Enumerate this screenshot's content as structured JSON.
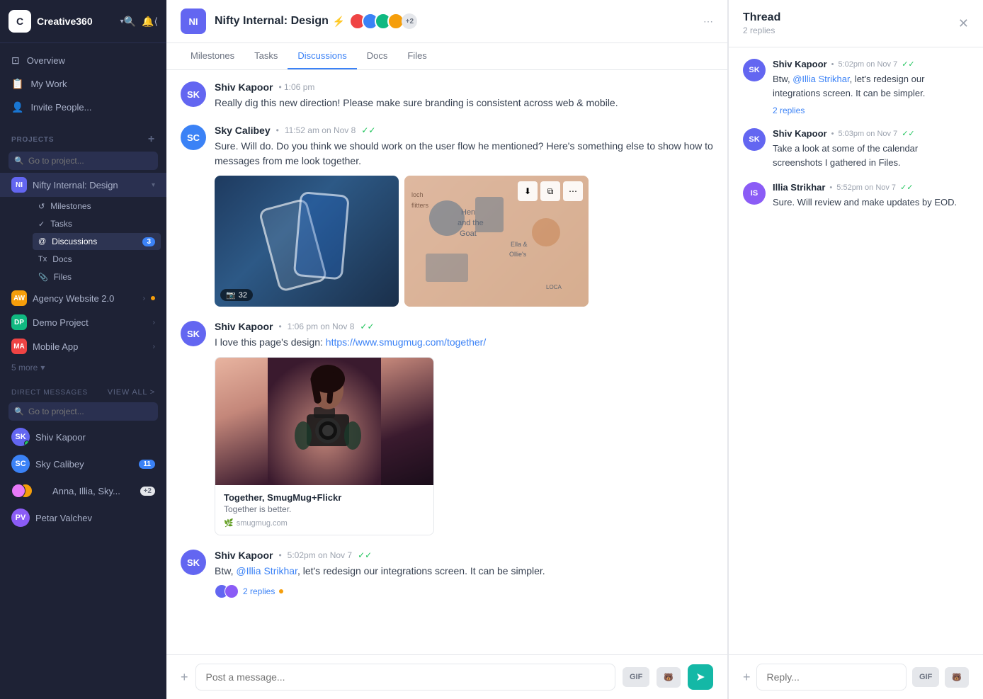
{
  "sidebar": {
    "brand": {
      "logo": "C",
      "name": "Creative360",
      "chevron": "▾"
    },
    "nav": {
      "overview_label": "Overview",
      "my_work_label": "My Work",
      "invite_label": "Invite People..."
    },
    "projects_section_label": "PROJECTS",
    "projects_search_placeholder": "Go to project...",
    "projects": [
      {
        "id": "NI",
        "name": "Nifty Internal: Design",
        "color": "#6366f1",
        "active": true
      },
      {
        "id": "AW",
        "name": "Agency Website 2.0",
        "color": "#f59e0b",
        "dot": true
      },
      {
        "id": "DP",
        "name": "Demo Project",
        "color": "#10b981"
      },
      {
        "id": "MA",
        "name": "Mobile App",
        "color": "#ef4444"
      }
    ],
    "more_label": "5 more",
    "ni_sub_nav": [
      {
        "icon": "↺",
        "label": "Milestones"
      },
      {
        "icon": "✓",
        "label": "Tasks"
      },
      {
        "icon": "@",
        "label": "Discussions",
        "badge": "3",
        "active": true
      },
      {
        "icon": "Tx",
        "label": "Docs"
      },
      {
        "icon": "📎",
        "label": "Files"
      }
    ],
    "dm_section_label": "DIRECT MESSAGES",
    "dm_view_all": "View all >",
    "dm_search_placeholder": "Go to project...",
    "dm_items": [
      {
        "name": "Shiv Kapoor",
        "color": "#6366f1",
        "initials": "SK",
        "online": true
      },
      {
        "name": "Sky Calibey",
        "color": "#3b82f6",
        "initials": "SC",
        "badge": "11"
      },
      {
        "name": "Anna, Illia, Sky...",
        "multi": true
      },
      {
        "name": "Petar Valchev",
        "color": "#8b5cf6",
        "initials": "PV"
      }
    ]
  },
  "project_header": {
    "avatar_text": "NI",
    "title": "Nifty Internal: Design",
    "member_count_extra": "+2",
    "tabs": [
      "Milestones",
      "Tasks",
      "Discussions",
      "Docs",
      "Files"
    ],
    "active_tab": "Discussions"
  },
  "messages": [
    {
      "id": "msg1",
      "author": "Sky Calibey",
      "author_color": "#3b82f6",
      "author_initials": "SC",
      "time": "11:52 am on Nov 8",
      "verified": true,
      "text": "Sure. Will do. Do you think we should work on the user flow he mentioned? Here's something else to show how to messages from me look together.",
      "has_images": true,
      "image_count": 32
    },
    {
      "id": "msg2",
      "author": "Shiv Kapoor",
      "author_color": "#6366f1",
      "author_initials": "SK",
      "time": "1:06 pm on Nov 8",
      "verified": true,
      "text_prefix": "I love this page's design: ",
      "link": "https://www.smugmug.com/together/",
      "has_link_preview": true,
      "link_preview_title": "Together, SmugMug+Flickr",
      "link_preview_subtitle": "Together is better.",
      "link_preview_domain": "smugmug.com"
    },
    {
      "id": "msg3",
      "author": "Shiv Kapoor",
      "author_color": "#6366f1",
      "author_initials": "SK",
      "time": "5:02pm on Nov 7",
      "verified": true,
      "text_prefix": "Btw, ",
      "mention": "@Illia Strikhar",
      "text_suffix": ", let's redesign our integrations screen. It can be simpler.",
      "replies_count": "2 replies",
      "has_replies": true
    }
  ],
  "message_input": {
    "placeholder": "Post a message...",
    "gif_label": "GIF",
    "send_icon": "➤"
  },
  "thread": {
    "title": "Thread",
    "reply_count": "2 replies",
    "messages": [
      {
        "author": "Shiv Kapoor",
        "author_color": "#6366f1",
        "author_initials": "SK",
        "time": "5:02pm on Nov 7",
        "verified": true,
        "text_prefix": "Btw, ",
        "mention": "@Illia Strikhar",
        "text_suffix": ", let's redesign our integrations screen. It can be simpler.",
        "sub_reply_count": "2 replies"
      },
      {
        "author": "Shiv Kapoor",
        "author_color": "#6366f1",
        "author_initials": "SK",
        "time": "5:03pm on Nov 7",
        "verified": true,
        "text": "Take a look at some of the calendar screenshots I gathered in Files."
      },
      {
        "author": "Illia Strikhar",
        "author_color": "#8b5cf6",
        "author_initials": "IS",
        "time": "5:52pm on Nov 7",
        "verified": true,
        "text": "Sure. Will review and make updates by EOD."
      }
    ],
    "input_placeholder": "Reply..."
  },
  "prev_message": {
    "author": "Shiv Kapoor",
    "time": "• 1:06 pm",
    "text": "Really dig this new direction! Please make sure branding is consistent across web & mobile."
  }
}
